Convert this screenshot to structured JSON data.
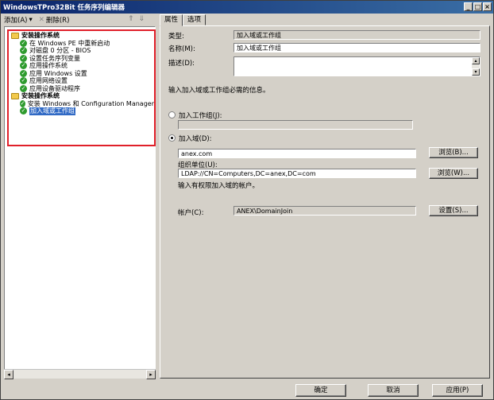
{
  "window": {
    "title": "WindowsTPro32Bit 任务序列编辑器",
    "controls": [
      "_",
      "□",
      "×"
    ]
  },
  "toolbar": {
    "add_label": "添加(A)",
    "delete_label": "删除(R)"
  },
  "tree": [
    {
      "type": "group",
      "label": "安装操作系统"
    },
    {
      "type": "step",
      "label": "在 Windows PE 中重新启动"
    },
    {
      "type": "step",
      "label": "对磁盘 0 分区 - BIOS"
    },
    {
      "type": "step",
      "label": "设置任务序列变量"
    },
    {
      "type": "step",
      "label": "应用操作系统"
    },
    {
      "type": "step",
      "label": "应用 Windows 设置"
    },
    {
      "type": "step",
      "label": "应用网络设置"
    },
    {
      "type": "step",
      "label": "应用设备驱动程序"
    },
    {
      "type": "group",
      "label": "安装操作系统"
    },
    {
      "type": "step",
      "label": "安装 Windows 和 Configuration Manager"
    },
    {
      "type": "step",
      "label": "加入域或工作组",
      "selected": true
    }
  ],
  "tabs": [
    {
      "label": "属性",
      "active": true
    },
    {
      "label": "选项",
      "active": false
    }
  ],
  "props": {
    "type_label": "类型:",
    "type_value": "加入域或工作组",
    "name_label": "名称(M):",
    "name_value": "加入域或工作组",
    "desc_label": "描述(D):",
    "desc_value": "",
    "info_text": "输入加入域或工作组必需的信息。",
    "workgroup_label": "加入工作组(J):",
    "workgroup_value": "",
    "domain_label": "加入域(D):",
    "domain_value": "anex.com",
    "ou_label": "组织单位(U):",
    "ou_value": "LDAP://CN=Computers,DC=anex,DC=com",
    "account_hint": "输入有权限加入域的帐户。",
    "account_label": "帐户(C):",
    "account_value": "ANEX\\DomainJoin",
    "browse1_label": "浏览(B)...",
    "browse2_label": "浏览(W)...",
    "set_label": "设置(S)..."
  },
  "footer": {
    "ok_label": "确定",
    "cancel_label": "取消",
    "apply_label": "应用(P)"
  }
}
